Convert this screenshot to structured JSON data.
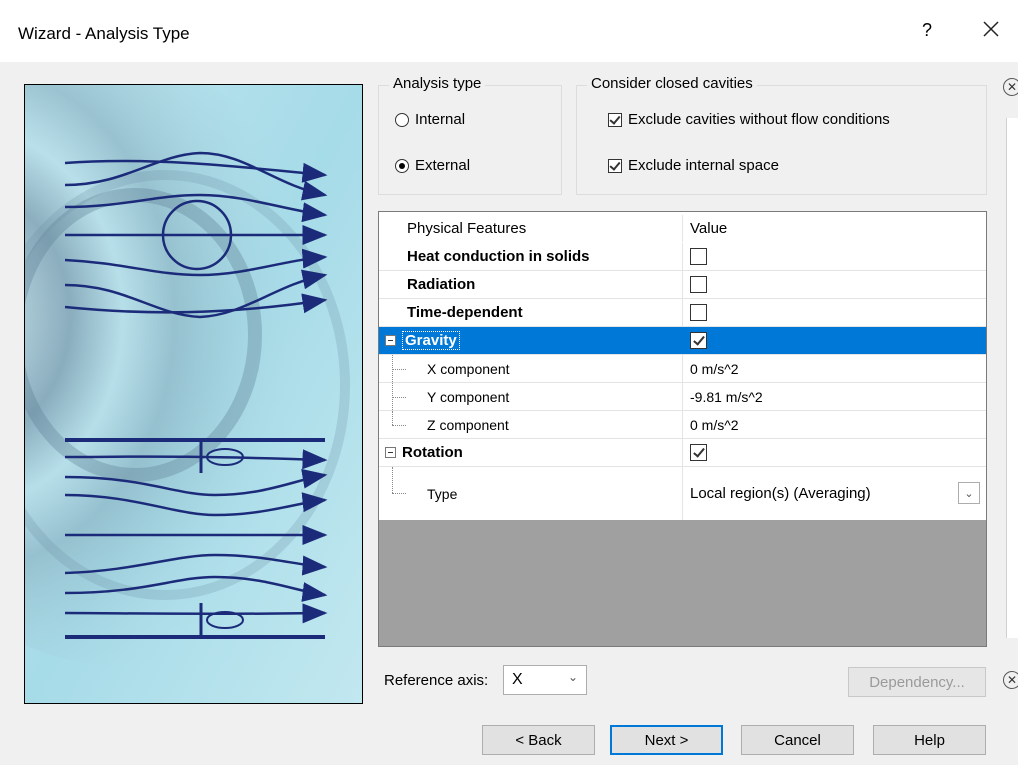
{
  "window": {
    "title": "Wizard - Analysis Type",
    "help_glyph": "?",
    "close_glyph": "✕"
  },
  "analysis_type": {
    "label": "Analysis type",
    "options": [
      "Internal",
      "External"
    ],
    "selected": "External"
  },
  "closed_cavities": {
    "label": "Consider closed cavities",
    "exclude_no_flow": {
      "label": "Exclude cavities without flow conditions",
      "checked": true
    },
    "exclude_internal": {
      "label": "Exclude internal space",
      "checked": true
    }
  },
  "grid": {
    "col_name": "Physical Features",
    "col_value": "Value",
    "rows": [
      {
        "label": "Heat conduction in solids",
        "bold": true,
        "checked": false
      },
      {
        "label": "Radiation",
        "bold": true,
        "checked": false
      },
      {
        "label": "Time-dependent",
        "bold": true,
        "checked": false
      },
      {
        "label": "Gravity",
        "bold": true,
        "checked": true,
        "selected": true,
        "expanded": true
      },
      {
        "label": "X component",
        "value": "0 m/s^2"
      },
      {
        "label": "Y component",
        "value": "-9.81 m/s^2"
      },
      {
        "label": "Z component",
        "value": "0 m/s^2"
      },
      {
        "label": "Rotation",
        "bold": true,
        "checked": true,
        "expanded": true
      },
      {
        "label": "Type",
        "value": "Local region(s) (Averaging)"
      }
    ]
  },
  "reference_axis": {
    "label": "Reference axis:",
    "value": "X"
  },
  "buttons": {
    "dependency": "Dependency...",
    "back": "< Back",
    "next": "Next >",
    "cancel": "Cancel",
    "help": "Help"
  },
  "colors": {
    "selection": "#0078d7",
    "image_tint": "#9fd8e6",
    "lines": "#1b2b7a"
  },
  "icons": {
    "side_collapse": "collapse-panel-icon",
    "side_expand": "expand-panel-icon"
  }
}
